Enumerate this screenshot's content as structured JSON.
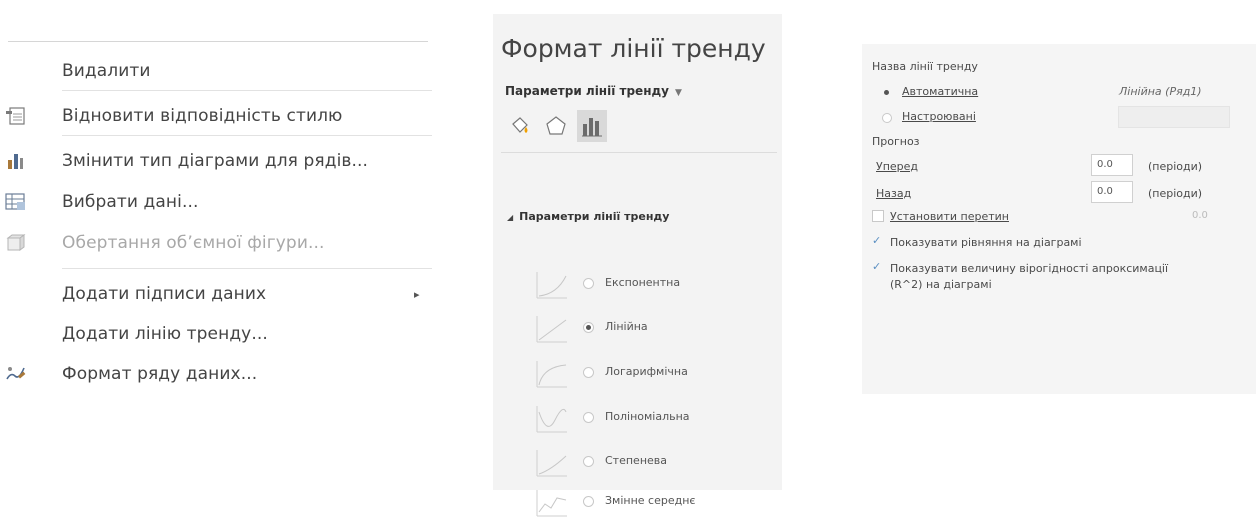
{
  "context_menu": {
    "items": [
      {
        "label": "Видалити",
        "icon": "",
        "disabled": false
      },
      {
        "label": "Відновити відповідність стилю",
        "icon": "reset-style-icon",
        "disabled": false
      },
      {
        "label": "Змінити тип діаграми для рядів...",
        "icon": "chart-type-icon",
        "disabled": false
      },
      {
        "label": "Вибрати дані...",
        "icon": "select-data-icon",
        "disabled": false
      },
      {
        "label": "Обертання об’ємної фігури...",
        "icon": "rotation-3d-icon",
        "disabled": true
      },
      {
        "label": "Додати підписи даних",
        "icon": "",
        "disabled": false,
        "submenu": true
      },
      {
        "label": "Додати лінію тренду...",
        "icon": "",
        "disabled": false
      },
      {
        "label": "Формат ряду даних...",
        "icon": "format-series-icon",
        "disabled": false
      }
    ],
    "submenu_arrow": "▸"
  },
  "format_pane": {
    "title": "Формат лінії тренду",
    "subtitle": "Параметри лінії тренду",
    "caret": "▼",
    "tabs": [
      "fill-line-icon",
      "effects-pentagon-icon",
      "trendline-options-icon"
    ],
    "section_title": "Параметри лінії тренду",
    "section_toggle": "◢",
    "options": [
      {
        "label": "Експонентна",
        "selected": false
      },
      {
        "label": "Лінійна",
        "selected": true
      },
      {
        "label": "Логарифмічна",
        "selected": false
      },
      {
        "label": "Поліноміальна",
        "selected": false
      },
      {
        "label": "Степенева",
        "selected": false
      },
      {
        "label": "Змінне середнє",
        "selected": false
      }
    ]
  },
  "options_panel": {
    "name_heading": "Назва лінії тренду",
    "auto_label": "Автоматична",
    "auto_value": "Лінійна (Ряд1)",
    "custom_label": "Настроювані",
    "forecast_heading": "Прогноз",
    "forward_label": "Уперед",
    "forward_value": "0.0",
    "forward_unit": "(періоди)",
    "backward_label": "Назад",
    "backward_value": "0.0",
    "backward_unit": "(періоди)",
    "intercept_label": "Установити перетин",
    "intercept_value": "0.0",
    "show_equation_label": "Показувати рівняння на діаграмі",
    "show_r2_label_line1": "Показувати величину вірогідності апроксимації",
    "show_r2_label_line2": "(R^2) на діаграмі"
  }
}
